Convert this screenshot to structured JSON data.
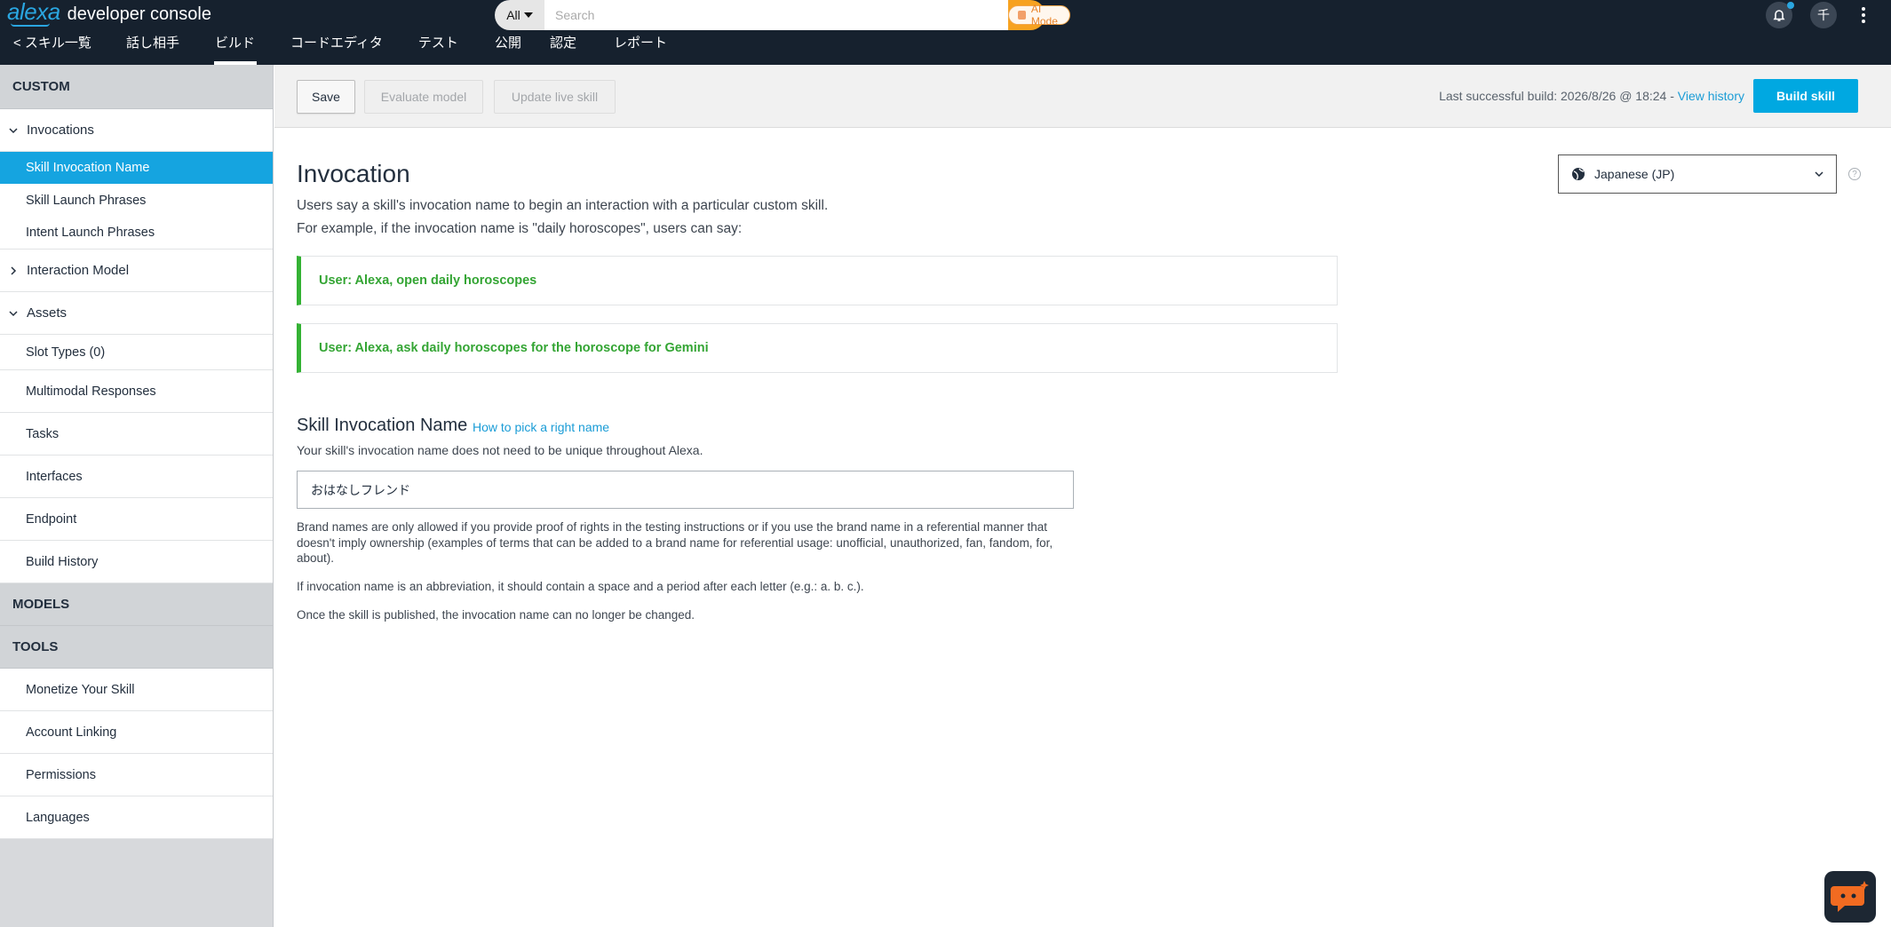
{
  "brand": {
    "logo": "alexa",
    "title": "developer console"
  },
  "search": {
    "scope": "All",
    "placeholder": "Search",
    "ai_mode": "AI Mode"
  },
  "user": {
    "avatar_initial": "千"
  },
  "nav": {
    "back_label": "< スキル一覧",
    "items": [
      {
        "label": "話し相手"
      },
      {
        "label": "ビルド",
        "active": true
      },
      {
        "label": "コードエディタ"
      },
      {
        "label": "テスト"
      },
      {
        "label": "公開"
      },
      {
        "label": "認定"
      },
      {
        "label": "レポート"
      }
    ]
  },
  "sidebar": {
    "custom_header": "CUSTOM",
    "invocations": "Invocations",
    "invocation_items": [
      "Skill Invocation Name",
      "Skill Launch Phrases",
      "Intent Launch Phrases"
    ],
    "interaction_model": "Interaction Model",
    "assets": "Assets",
    "slot_types": "Slot Types (0)",
    "items": [
      "Multimodal Responses",
      "Tasks",
      "Interfaces",
      "Endpoint",
      "Build History"
    ],
    "models_header": "MODELS",
    "tools_header": "TOOLS",
    "tool_items": [
      "Monetize Your Skill",
      "Account Linking",
      "Permissions",
      "Languages"
    ]
  },
  "toolbar": {
    "save": "Save",
    "evaluate": "Evaluate model",
    "update_live": "Update live skill",
    "last_build": "Last successful build: 2026/8/26 @ 18:24 - ",
    "view_history": "View history",
    "build_skill": "Build skill"
  },
  "main": {
    "title": "Invocation",
    "desc_line1": "Users say a skill's invocation name to begin an interaction with a particular custom skill.",
    "desc_line2": "For example, if the invocation name is \"daily horoscopes\", users can say:",
    "examples": [
      "User: Alexa, open daily horoscopes",
      "User: Alexa, ask daily horoscopes for the horoscope for Gemini"
    ],
    "language": "Japanese (JP)",
    "help": "?",
    "section_title": "Skill Invocation Name",
    "section_link": "How to pick a right name",
    "section_sub": "Your skill's invocation name does not need to be unique throughout Alexa.",
    "invocation_name_value": "おはなしフレンド",
    "note1": "Brand names are only allowed if you provide proof of rights in the testing instructions or if you use the brand name in a referential manner that doesn't imply ownership (examples of terms that can be added to a brand name for referential usage: unofficial, unauthorized, fan, fandom, for, about).",
    "note2": "If invocation name is an abbreviation, it should contain a space and a period after each letter (e.g.: a. b. c.).",
    "note3": "Once the skill is published, the invocation name can no longer be changed."
  },
  "colors": {
    "accent": "#00a8e1",
    "topbar": "#16212e",
    "example_green": "#34b234",
    "search_orange": "#f7a220"
  }
}
